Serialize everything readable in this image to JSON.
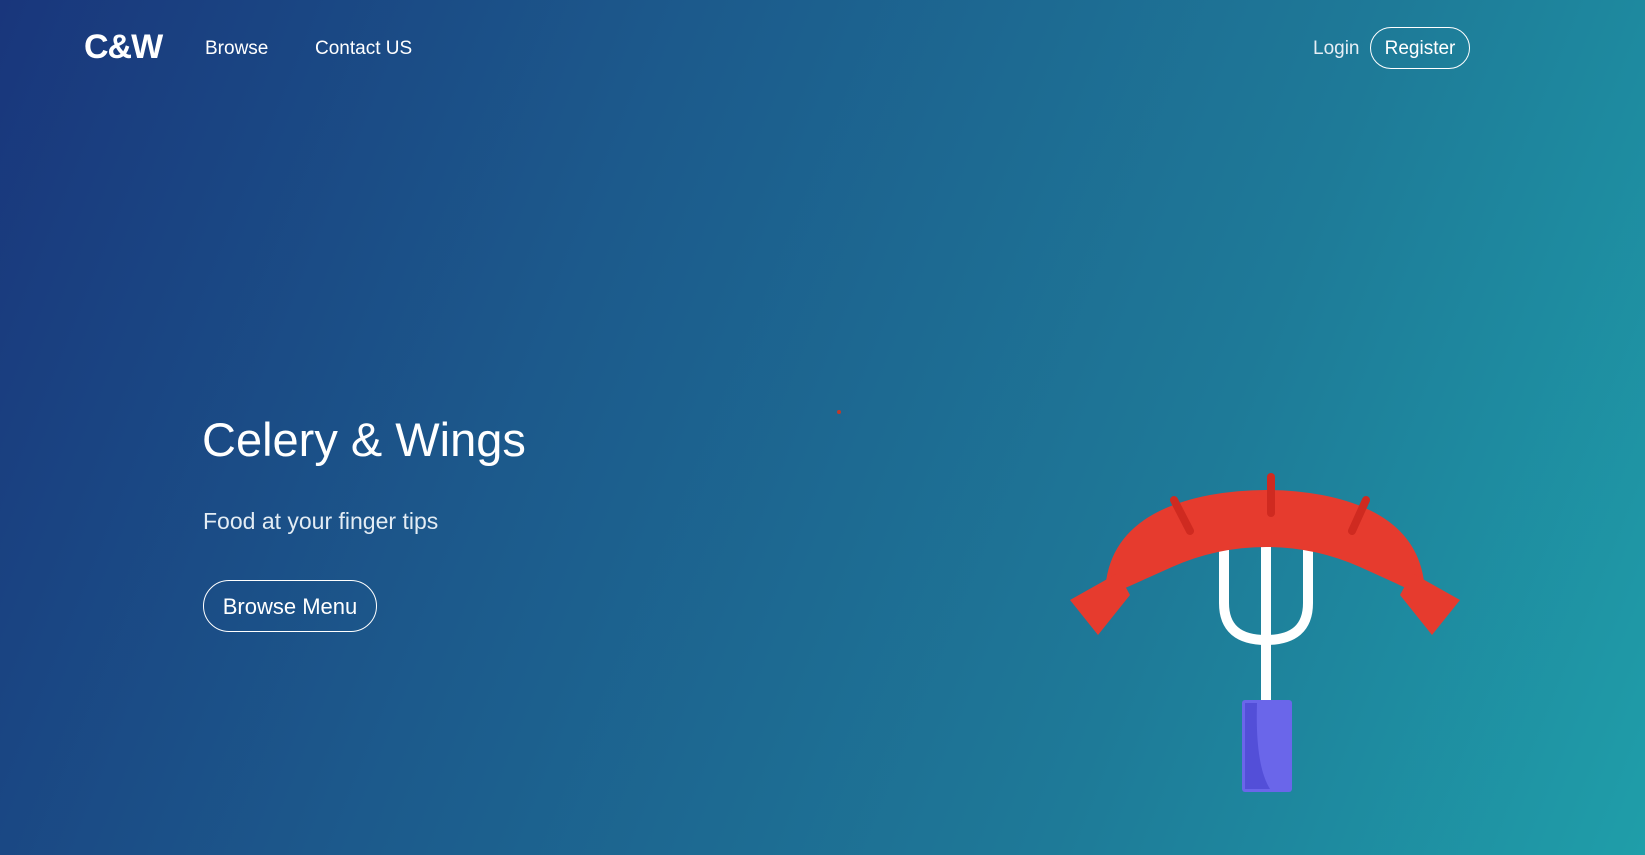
{
  "nav": {
    "brand": "C&W",
    "links": [
      {
        "label": "Browse"
      },
      {
        "label": "Contact US"
      }
    ],
    "login_label": "Login",
    "register_label": "Register"
  },
  "hero": {
    "title": "Celery & Wings",
    "subtitle": "Food at your finger tips",
    "cta_label": "Browse Menu"
  },
  "illustration": {
    "icon": "sausage-on-fork-icon",
    "colors": {
      "sausage": "#e63b2e",
      "sausage_marks": "#cf2a20",
      "fork": "#ffffff",
      "handle": "#6a66ea",
      "handle_shadow": "#534fd8"
    }
  },
  "theme": {
    "gradient_start": "#19367c",
    "gradient_end": "#1f9ea9",
    "text": "#ffffff"
  }
}
